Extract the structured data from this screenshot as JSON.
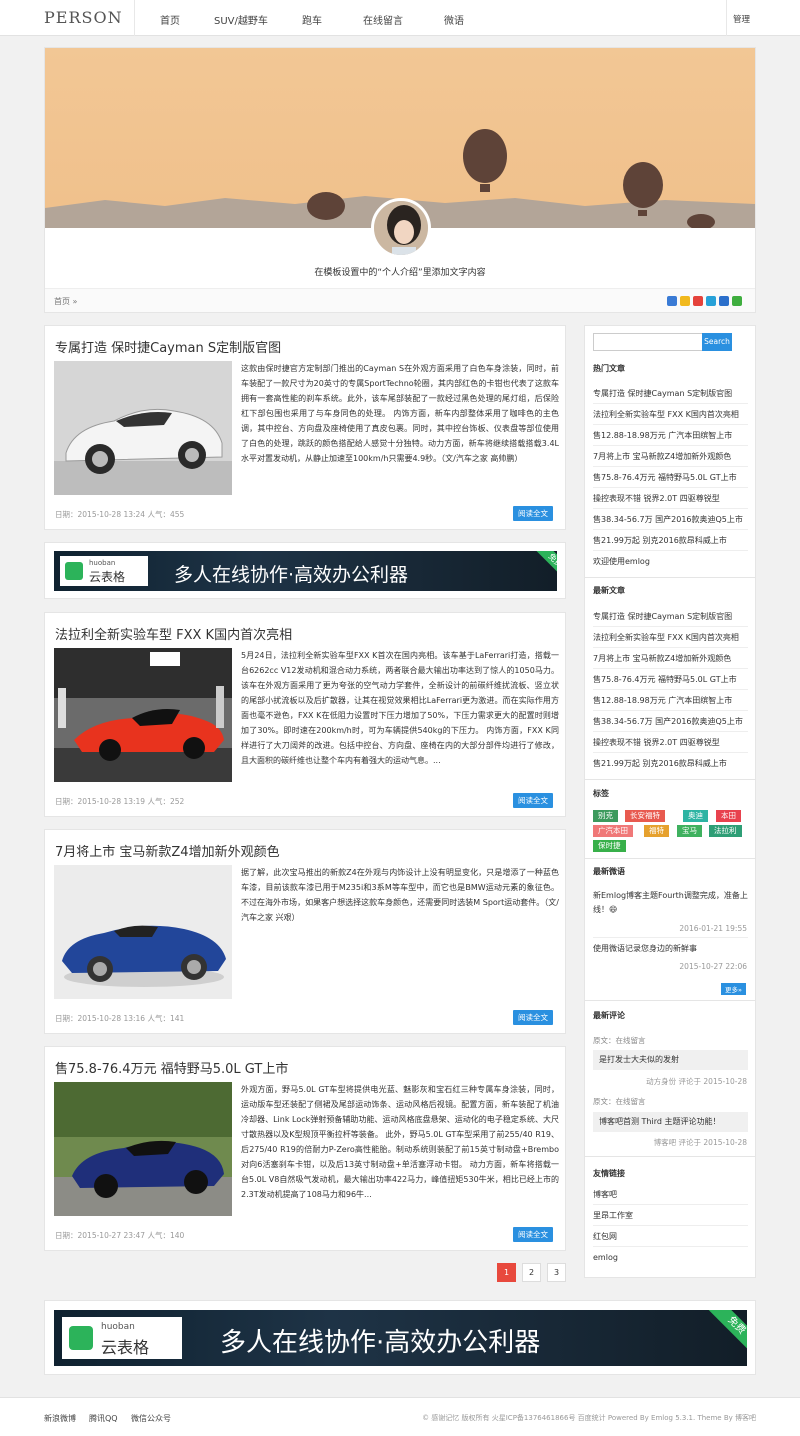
{
  "site": {
    "logo": "PERSON",
    "admin": "管理"
  },
  "nav": [
    "首页",
    "SUV/越野车",
    "跑车",
    "在线留言",
    "微语"
  ],
  "banner": {
    "intro": "在模板设置中的“个人介绍”里添加文字内容"
  },
  "breadcrumb": "首页 »",
  "posts": [
    {
      "title": "专属打造 保时捷Cayman S定制版官图",
      "body": "这款由保时捷官方定制部门推出的Cayman S在外观方面采用了白色车身涂装，同时，前车装配了一款尺寸为20英寸的专属SportTechno轮圈，其内部红色的卡钳也代表了这款车拥有一套高性能的刹车系统。此外，该车尾部装配了一款经过黑色处理的尾灯组，后保险杠下部包围也采用了与车身同色的处理。 内饰方面，新车内部整体采用了咖啡色的主色调，其中控台、方向盘及座椅使用了真皮包裹。同时，其中控台饰板、仪表盘等部位使用了白色的处理，跳跃的颜色搭配给人感觉十分独特。动力方面，新车将继续搭载搭载3.4L水平对置发动机，从静止加速至100km/h只需要4.9秒。（文/汽车之家 高帅鹏）",
      "meta": "日期：2015-10-28 13:24   人气：455",
      "read": "阅读全文"
    },
    {
      "title": "法拉利全新实验车型 FXX K国内首次亮相",
      "body": "5月24日，法拉利全新实验车型FXX K首次在国内亮相。该车基于LaFerrari打造，搭载一台6262cc V12发动机和混合动力系统，两者联合最大输出功率达到了惊人的1050马力。 该车在外观方面采用了更为夸张的空气动力学套件，全新设计的前碳纤维扰流板、竖立状的尾部小扰流板以及后扩散器，让其在视觉效果相比LaFerrari更为激进。而在实际作用方面也毫不逊色，FXX K在低阻力设置时下压力增加了50%，下压力需求更大的配置时则增加了30%。即时速在200km/h时，可为车辆提供540kg的下压力。 内饰方面，FXX K同样进行了大刀阔斧的改进。包括中控台、方向盘、座椅在内的大部分部件均进行了修改，且大面积的碳纤维也让整个车内有着强大的运动气息。...",
      "meta": "日期：2015-10-28 13:19   人气：252",
      "read": "阅读全文"
    },
    {
      "title": "7月将上市 宝马新款Z4增加新外观颜色",
      "body": "据了解，此次宝马推出的新款Z4在外观与内饰设计上没有明显变化，只是增添了一种蓝色车漆，目前该款车漆已用于M235i和3系M等车型中，而它也是BMW运动元素的象征色。不过在海外市场，如果客户想选择这款车身颜色，还需要同时选装M Sport运动套件。（文/汽车之家 兴艰）",
      "meta": "日期：2015-10-28 13:16   人气：141",
      "read": "阅读全文"
    },
    {
      "title": "售75.8-76.4万元 福特野马5.0L GT上市",
      "body": "外观方面，野马5.0L GT车型将提供电光蓝、魅影灰和宝石红三种专属车身涂装，同时，运动版车型还装配了侧裙及尾部运动饰条、运动风格后视镜。配置方面，新车装配了机油冷却器、Link Lock弹射预备辅助功能、运动风格底盘悬架、运动化的电子稳定系统、大尺寸散热器以及K型规顶平衡拉杆等装备。 此外，野马5.0L GT车型采用了前255/40 R19、后275/40 R19的倍耐力P-Zero高性能胎。制动系统则装配了前15英寸制动盘+Brembo对向6活塞刹车卡钳，以及后13英寸制动盘+单活塞浮动卡钳。 动力方面，新车将搭载一台5.0L V8自然吸气发动机，最大输出功率422马力，峰值扭矩530牛米，相比已经上市的2.3T发动机提高了108马力和96牛...",
      "meta": "日期：2015-10-27 23:47   人气：140",
      "read": "阅读全文"
    }
  ],
  "ad": {
    "brand_en": "huoban",
    "brand_cn": "云表格",
    "slogan": "多人在线协作·高效办公利器",
    "ribbon": "免费"
  },
  "pagination": [
    "1",
    "2",
    "3"
  ],
  "sidebar": {
    "search_button": "Search",
    "hot_title": "热门文章",
    "hot": [
      "专属打造 保时捷Cayman S定制版官图",
      "法拉利全新实验车型 FXX K国内首次亮相",
      "售12.88-18.98万元 广汽本田缤智上市",
      "7月将上市 宝马新款Z4增加新外观颜色",
      "售75.8-76.4万元 福特野马5.0L GT上市",
      "操控表现不错 锐界2.0T 四驱尊锐型",
      "售38.34-56.7万 国产2016款奥迪Q5上市",
      "售21.99万起 别克2016款昂科威上市",
      "欢迎使用emlog"
    ],
    "new_title": "最新文章",
    "new": [
      "专属打造 保时捷Cayman S定制版官图",
      "法拉利全新实验车型 FXX K国内首次亮相",
      "7月将上市 宝马新款Z4增加新外观颜色",
      "售75.8-76.4万元 福特野马5.0L GT上市",
      "售12.88-18.98万元 广汽本田缤智上市",
      "售38.34-56.7万 国产2016款奥迪Q5上市",
      "操控表现不错 锐界2.0T 四驱尊锐型",
      "售21.99万起 别克2016款昂科威上市"
    ],
    "tags_title": "标签",
    "tags": [
      "别克",
      "长安福特",
      "奥迪",
      "本田",
      "广汽本田",
      "福特",
      "宝马",
      "法拉利",
      "保时捷"
    ],
    "tw_title": "最新微语",
    "tw1": "新Emlog博客主题Fourth调整完成，准备上线！😄",
    "tw1_time": "2016-01-21 19:55",
    "tw2": "使用微语记录您身边的新鲜事",
    "tw2_time": "2015-10-27 22:06",
    "more": "更多»",
    "cm_title": "最新评论",
    "c1_src": "原文：在线留言",
    "c1_text": "是打发士大夫似的发射",
    "c1_meta": "动方身份 评论于 2015-10-28",
    "c2_src": "原文：在线留言",
    "c2_text": "博客吧首测 Third 主题评论功能！",
    "c2_meta": "博客吧 评论于 2015-10-28",
    "links_title": "友情链接",
    "links": [
      "博客吧",
      "里昂工作室",
      "红包网",
      "emlog"
    ]
  },
  "footer": {
    "links": [
      "新浪微博",
      "腾讯QQ",
      "微信公众号"
    ],
    "copyright": "© 感谢记忆 版权所有 火星ICP备1376461866号 百度统计 Powered By Emlog 5.3.1. Theme By 博客吧"
  },
  "colors": {
    "accent": "#2a90e0",
    "tag_palette": [
      "#3c9a5d",
      "#e85a4f",
      "#2db4a3",
      "#e8424e",
      "#f07878",
      "#e6a12e",
      "#3fb15f",
      "#2e9e76",
      "#38b04a"
    ]
  }
}
